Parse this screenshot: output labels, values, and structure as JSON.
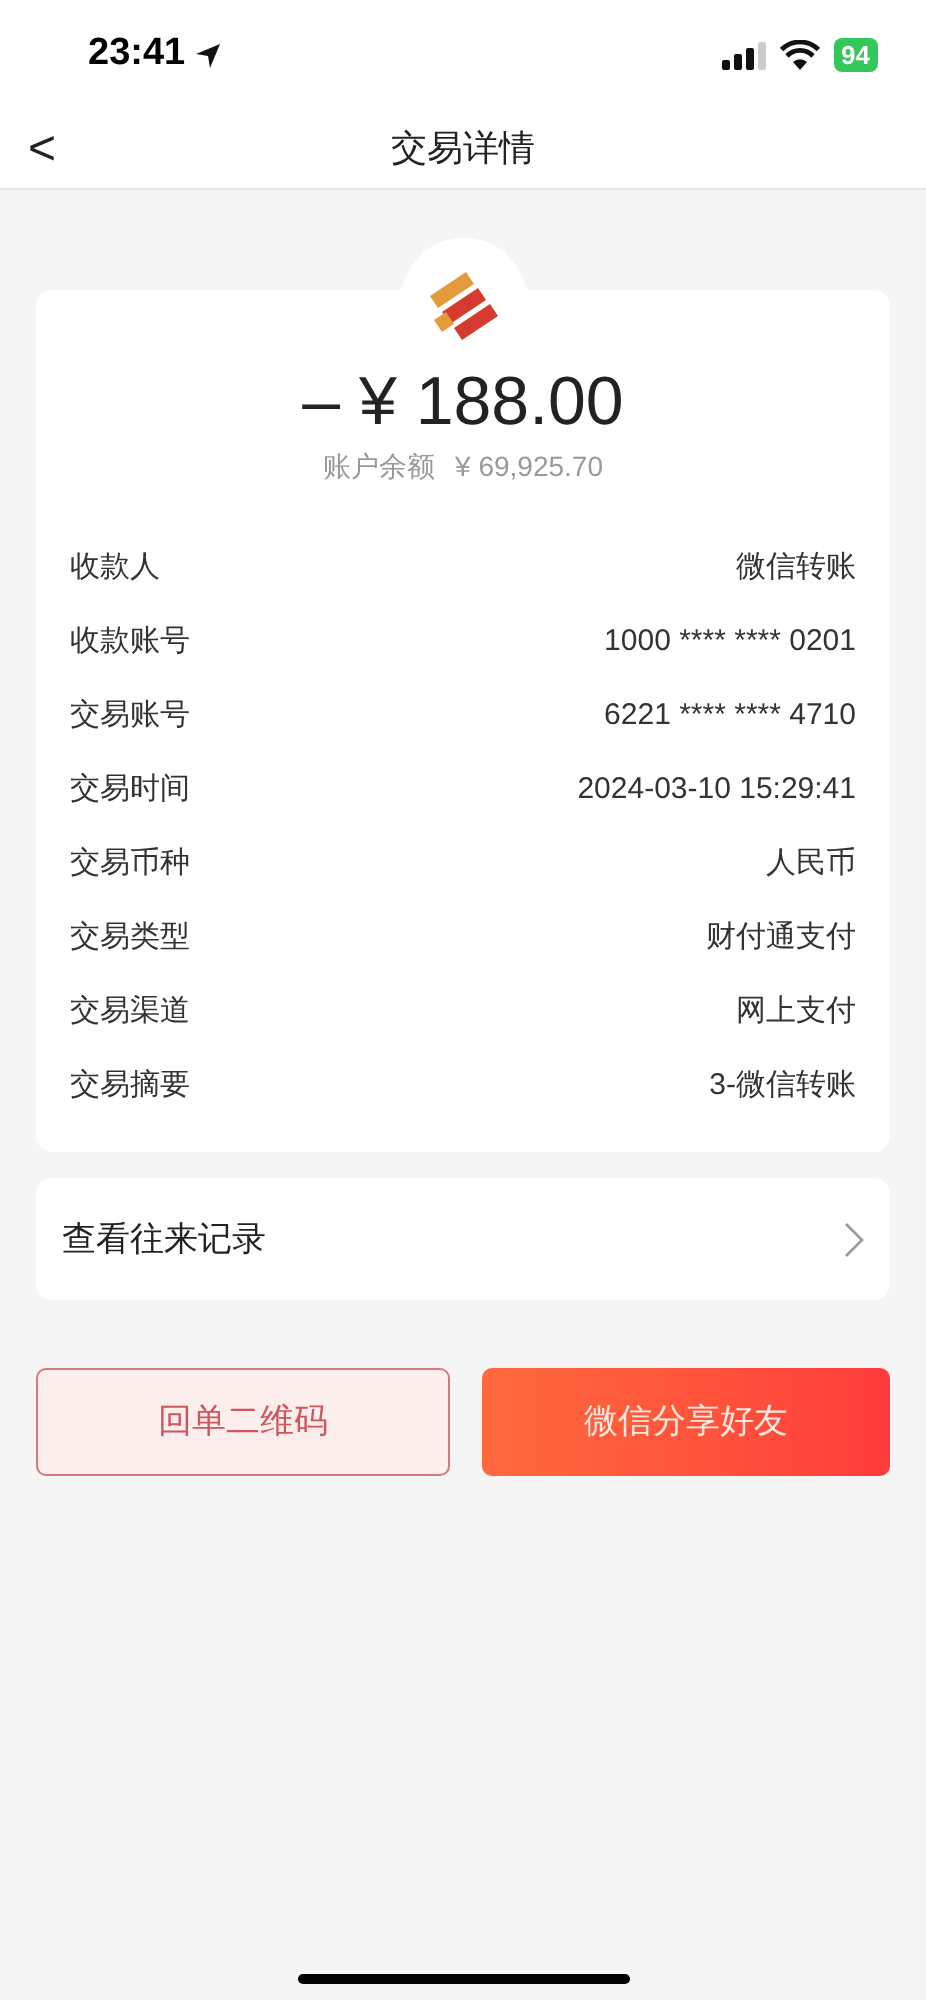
{
  "status_bar": {
    "time": "23:41",
    "battery": "94"
  },
  "nav": {
    "back": "<",
    "title": "交易详情"
  },
  "summary": {
    "amount": "– ¥ 188.00",
    "balance_label": "账户余额",
    "balance": "¥ 69,925.70"
  },
  "details": [
    {
      "label": "收款人",
      "value": "微信转账"
    },
    {
      "label": "收款账号",
      "value": "1000 **** **** 0201"
    },
    {
      "label": "交易账号",
      "value": "6221 **** **** 4710"
    },
    {
      "label": "交易时间",
      "value": "2024-03-10 15:29:41"
    },
    {
      "label": "交易币种",
      "value": "人民币"
    },
    {
      "label": "交易类型",
      "value": "财付通支付"
    },
    {
      "label": "交易渠道",
      "value": "网上支付"
    },
    {
      "label": "交易摘要",
      "value": "3-微信转账"
    }
  ],
  "history_link": {
    "label": "查看往来记录"
  },
  "buttons": [
    {
      "label": "回单二维码",
      "kind": "outline"
    },
    {
      "label": "微信分享好友",
      "kind": "filled"
    }
  ]
}
